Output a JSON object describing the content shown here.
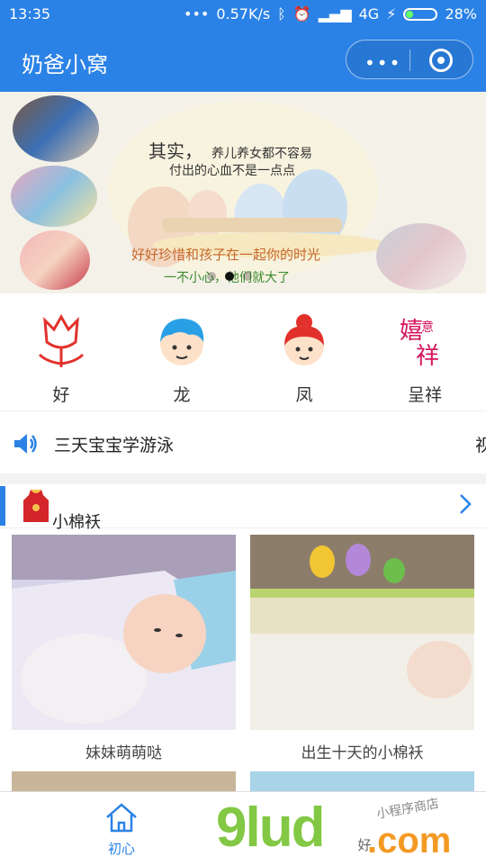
{
  "status_bar": {
    "time": "13:35",
    "network_speed": "0.57K/s",
    "signal_label": "4G",
    "battery": "28%"
  },
  "header": {
    "title": "奶爸小窝",
    "capsule_more": "•••"
  },
  "banner": {
    "line1": "其实，",
    "line1_small": "养儿养女都不容易",
    "line2": "付出的心血不是一点点",
    "line3": "好好珍惜和孩子在一起你的时光",
    "line4": "一不小心，他们就大了",
    "active_dot": 2,
    "dot_count": 3
  },
  "categories": [
    {
      "label": "好",
      "icon": "tulip-icon"
    },
    {
      "label": "龙",
      "icon": "boy-face-icon"
    },
    {
      "label": "凤",
      "icon": "girl-face-icon"
    },
    {
      "label": "呈祥",
      "icon": "chengxiang-emblem-icon"
    }
  ],
  "notice": {
    "text": "三天宝宝学游泳",
    "next_text": "视"
  },
  "section": {
    "title": "小棉袄"
  },
  "cards": [
    {
      "caption": "妹妹萌萌哒"
    },
    {
      "caption": "出生十天的小棉袄"
    }
  ],
  "tabbar": {
    "home_label": "初心",
    "second_label": "好"
  },
  "watermark": {
    "brand": "9lud",
    "domain": ".com",
    "tagline": "小程序商店"
  },
  "colors": {
    "brand_blue": "#2b82e6",
    "red_icon": "#e2312b"
  }
}
